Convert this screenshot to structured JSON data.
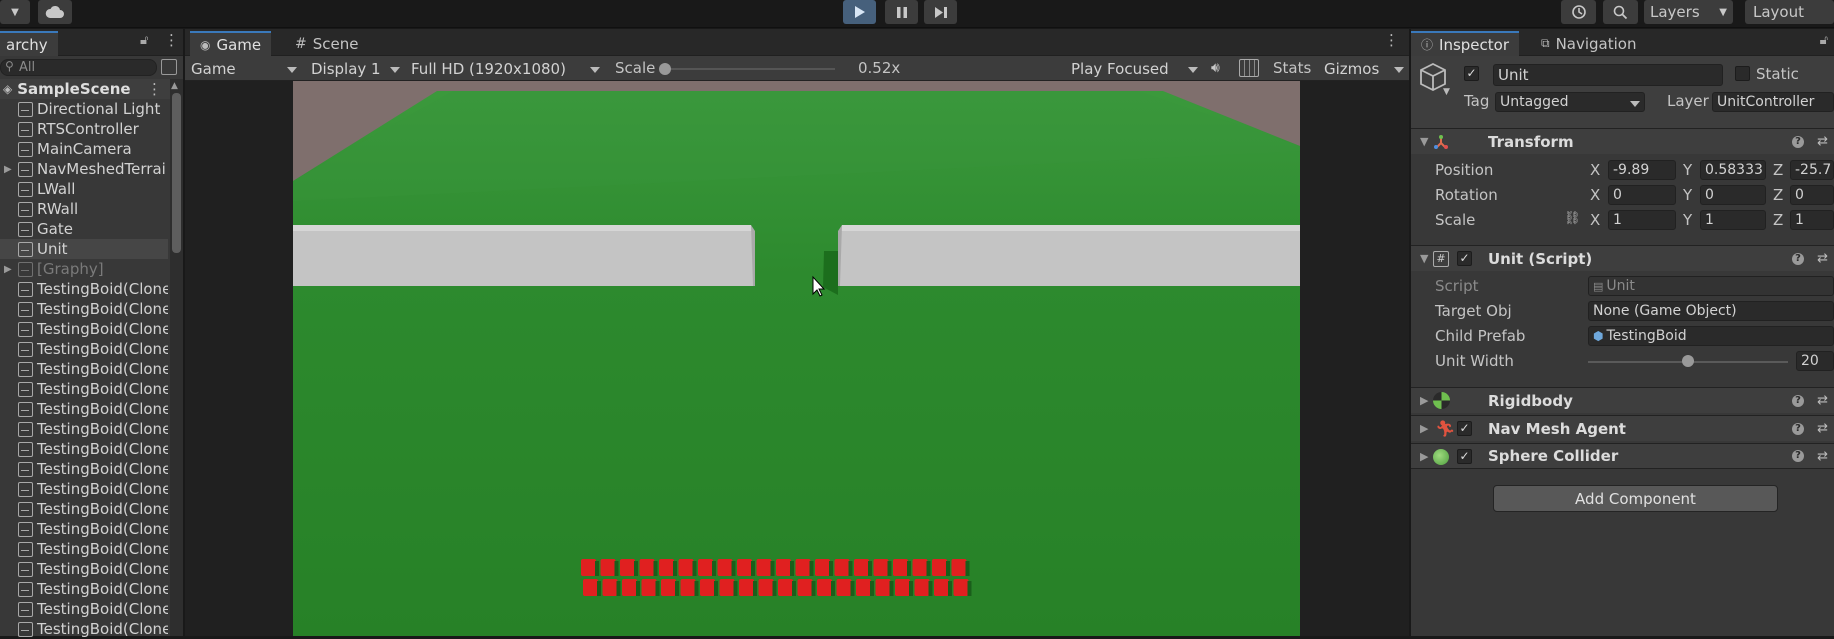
{
  "toolbar": {
    "layers_label": "Layers",
    "layout_label": "Layout",
    "play_icon": "play-icon",
    "pause_icon": "pause-icon",
    "step_icon": "step-icon"
  },
  "hierarchy": {
    "tab_label": "archy",
    "search_placeholder": "All",
    "scene_name": "SampleScene",
    "items": [
      {
        "label": "Directional Light"
      },
      {
        "label": "RTSController"
      },
      {
        "label": "MainCamera"
      },
      {
        "label": "NavMeshedTerrai",
        "expandable": true
      },
      {
        "label": "LWall"
      },
      {
        "label": "RWall"
      },
      {
        "label": "Gate"
      },
      {
        "label": "Unit",
        "selected": true
      },
      {
        "label": "[Graphy]",
        "expandable": true,
        "disabled": true
      },
      {
        "label": "TestingBoid(Clone"
      },
      {
        "label": "TestingBoid(Clone"
      },
      {
        "label": "TestingBoid(Clone"
      },
      {
        "label": "TestingBoid(Clone"
      },
      {
        "label": "TestingBoid(Clone"
      },
      {
        "label": "TestingBoid(Clone"
      },
      {
        "label": "TestingBoid(Clone"
      },
      {
        "label": "TestingBoid(Clone"
      },
      {
        "label": "TestingBoid(Clone"
      },
      {
        "label": "TestingBoid(Clone"
      },
      {
        "label": "TestingBoid(Clone"
      },
      {
        "label": "TestingBoid(Clone"
      },
      {
        "label": "TestingBoid(Clone"
      },
      {
        "label": "TestingBoid(Clone"
      },
      {
        "label": "TestingBoid(Clone"
      },
      {
        "label": "TestingBoid(Clone"
      },
      {
        "label": "TestingBoid(Clone"
      },
      {
        "label": "TestingBoid(Clone"
      }
    ]
  },
  "game": {
    "tabs": [
      "Game",
      "Scene"
    ],
    "mode": "Game",
    "display": "Display 1",
    "resolution": "Full HD (1920x1080)",
    "scale_label": "Scale",
    "scale_value": "0.52x",
    "scale_fraction": 0.0,
    "play_mode": "Play Focused",
    "stats_label": "Stats",
    "gizmos_label": "Gizmos",
    "unit_count": 40
  },
  "inspector": {
    "tabs": [
      "Inspector",
      "Navigation"
    ],
    "object_name": "Unit",
    "static_label": "Static",
    "tag_label": "Tag",
    "tag_value": "Untagged",
    "layer_label": "Layer",
    "layer_value": "UnitController",
    "transform": {
      "title": "Transform",
      "position_label": "Position",
      "rotation_label": "Rotation",
      "scale_label": "Scale",
      "position": {
        "x": "-9.89",
        "y": "0.58333",
        "z": "-25.7"
      },
      "rotation": {
        "x": "0",
        "y": "0",
        "z": "0"
      },
      "scale": {
        "x": "1",
        "y": "1",
        "z": "1"
      },
      "axis_x": "X",
      "axis_y": "Y",
      "axis_z": "Z"
    },
    "unit_script": {
      "title": "Unit (Script)",
      "script_label": "Script",
      "script_value": "Unit",
      "target_label": "Target Obj",
      "target_value": "None (Game Object)",
      "child_label": "Child Prefab",
      "child_value": "TestingBoid",
      "width_label": "Unit Width",
      "width_value": "20",
      "width_fraction": 0.5
    },
    "components": [
      {
        "title": "Rigidbody",
        "icon": "rigidbody-icon",
        "checkbox": false
      },
      {
        "title": "Nav Mesh Agent",
        "icon": "nav-mesh-agent-icon",
        "checkbox": true
      },
      {
        "title": "Sphere Collider",
        "icon": "sphere-collider-icon",
        "checkbox": true
      }
    ],
    "add_component_label": "Add Component"
  },
  "colors": {
    "accent": "#3a79bb",
    "ground": "#2d8a2e",
    "backdrop": "#7f6f6d",
    "wall": "#c9c9c9",
    "unit_red": "#e02020"
  }
}
